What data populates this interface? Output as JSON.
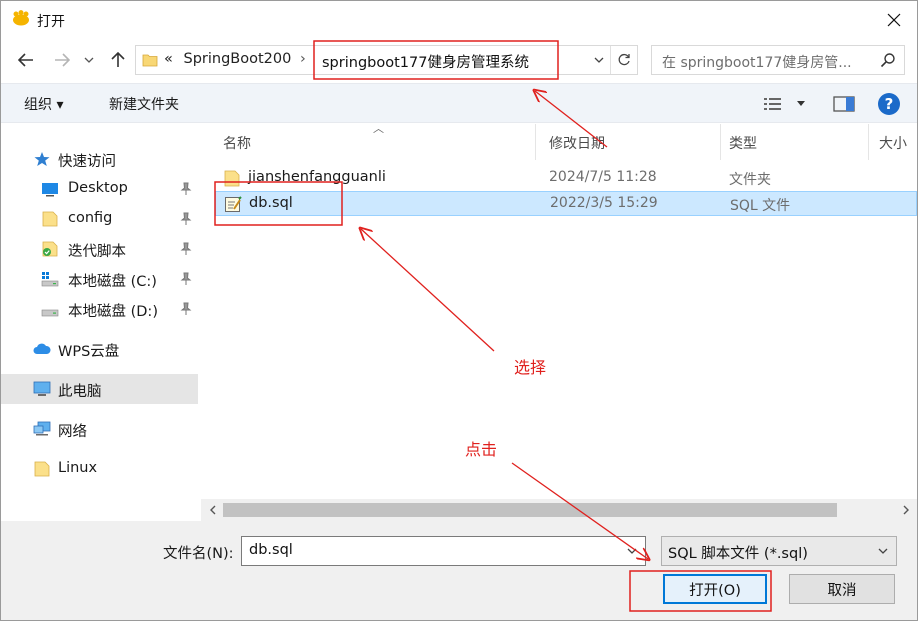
{
  "window": {
    "title": "打开"
  },
  "address_bar": {
    "prefix": "«",
    "crumb_parent": "SpringBoot200",
    "separator": "›",
    "current_folder": "springboot177健身房管理系统"
  },
  "search": {
    "placeholder": "在 springboot177健身房管..."
  },
  "toolbar": {
    "organize_label": "组织 ▾",
    "new_folder_label": "新建文件夹"
  },
  "sidebar": {
    "items": [
      {
        "label": "快速访问",
        "icon": "star-icon",
        "pinned": false,
        "selected": false
      },
      {
        "label": "Desktop",
        "icon": "desktop-icon",
        "pinned": true,
        "selected": false
      },
      {
        "label": "config",
        "icon": "folder-icon",
        "pinned": true,
        "selected": false
      },
      {
        "label": "迭代脚本",
        "icon": "script-folder-icon",
        "pinned": true,
        "selected": false
      },
      {
        "label": "本地磁盘 (C:)",
        "icon": "drive-c-icon",
        "pinned": true,
        "selected": false
      },
      {
        "label": "本地磁盘 (D:)",
        "icon": "drive-d-icon",
        "pinned": true,
        "selected": false
      },
      {
        "label": "WPS云盘",
        "icon": "cloud-icon",
        "pinned": false,
        "selected": false
      },
      {
        "label": "此电脑",
        "icon": "computer-icon",
        "pinned": false,
        "selected": true
      },
      {
        "label": "网络",
        "icon": "network-icon",
        "pinned": false,
        "selected": false
      },
      {
        "label": "Linux",
        "icon": "folder-icon",
        "pinned": false,
        "selected": false
      }
    ]
  },
  "columns": {
    "name": "名称",
    "modified": "修改日期",
    "type": "类型",
    "size": "大小"
  },
  "files": [
    {
      "name": "jianshenfangguanli",
      "modified": "2024/7/5 11:28",
      "type": "文件夹",
      "icon": "folder-icon",
      "selected": false
    },
    {
      "name": "db.sql",
      "modified": "2022/3/5 15:29",
      "type": "SQL 文件",
      "icon": "sql-file-icon",
      "selected": true
    }
  ],
  "bottom": {
    "filename_label": "文件名(N):",
    "filename_value": "db.sql",
    "filetype_value": "SQL 脚本文件 (*.sql)",
    "open_label": "打开(O)",
    "cancel_label": "取消"
  },
  "annotations": {
    "select_label": "选择",
    "click_label": "点击",
    "color": "#e0211e"
  }
}
